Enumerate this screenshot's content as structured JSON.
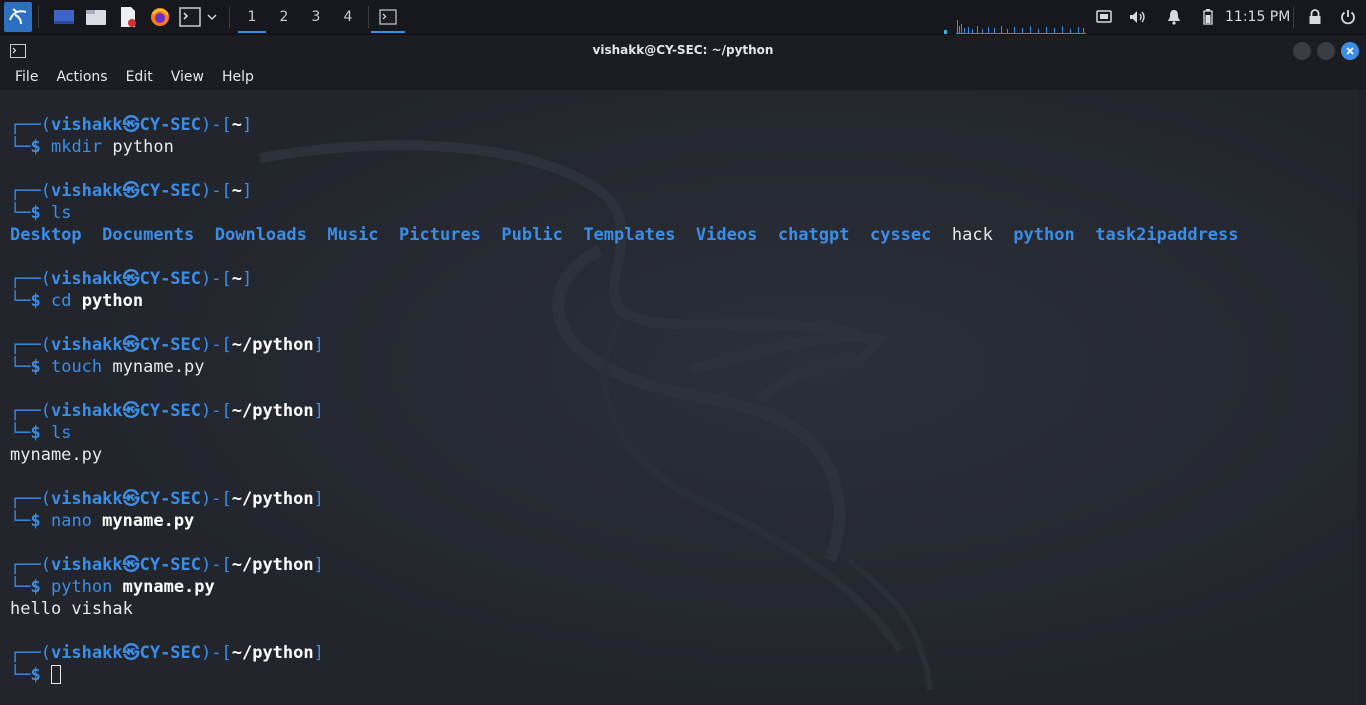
{
  "taskbar": {
    "workspaces": [
      "1",
      "2",
      "3",
      "4"
    ],
    "active_workspace": "1",
    "clock": "11:15 PM",
    "accent": "#3b8ee8"
  },
  "window": {
    "title": "vishakk@CY-SEC: ~/python",
    "menu": [
      "File",
      "Actions",
      "Edit",
      "View",
      "Help"
    ]
  },
  "terminal": {
    "user": "vishakk",
    "host": "CY-SEC",
    "blocks": [
      {
        "path": "~",
        "cmd": "mkdir",
        "arg": "python",
        "arg_bold": false,
        "output": ""
      },
      {
        "path": "~",
        "cmd": "ls",
        "arg": "",
        "arg_bold": false,
        "output": ""
      },
      {
        "path": "~",
        "cmd": "cd",
        "arg": "python",
        "arg_bold": true,
        "output": ""
      },
      {
        "path": "~/python",
        "cmd": "touch",
        "arg": "myname.py",
        "arg_bold": false,
        "output": ""
      },
      {
        "path": "~/python",
        "cmd": "ls",
        "arg": "",
        "arg_bold": false,
        "output": "myname.py"
      },
      {
        "path": "~/python",
        "cmd": "nano",
        "arg": "myname.py",
        "arg_bold": true,
        "output": ""
      },
      {
        "path": "~/python",
        "cmd": "python",
        "arg": "myname.py",
        "arg_bold": true,
        "output": "hello vishak"
      },
      {
        "path": "~/python",
        "cmd": "",
        "arg": "",
        "arg_bold": false,
        "output": ""
      }
    ],
    "ls_home": [
      {
        "name": "Desktop",
        "type": "dir"
      },
      {
        "name": "Documents",
        "type": "dir"
      },
      {
        "name": "Downloads",
        "type": "dir"
      },
      {
        "name": "Music",
        "type": "dir"
      },
      {
        "name": "Pictures",
        "type": "dir"
      },
      {
        "name": "Public",
        "type": "dir"
      },
      {
        "name": "Templates",
        "type": "dir"
      },
      {
        "name": "Videos",
        "type": "dir"
      },
      {
        "name": "chatgpt",
        "type": "dir"
      },
      {
        "name": "cyssec",
        "type": "dir"
      },
      {
        "name": "hack",
        "type": "file"
      },
      {
        "name": "python",
        "type": "dir"
      },
      {
        "name": "task2ipaddress",
        "type": "dir"
      }
    ]
  }
}
